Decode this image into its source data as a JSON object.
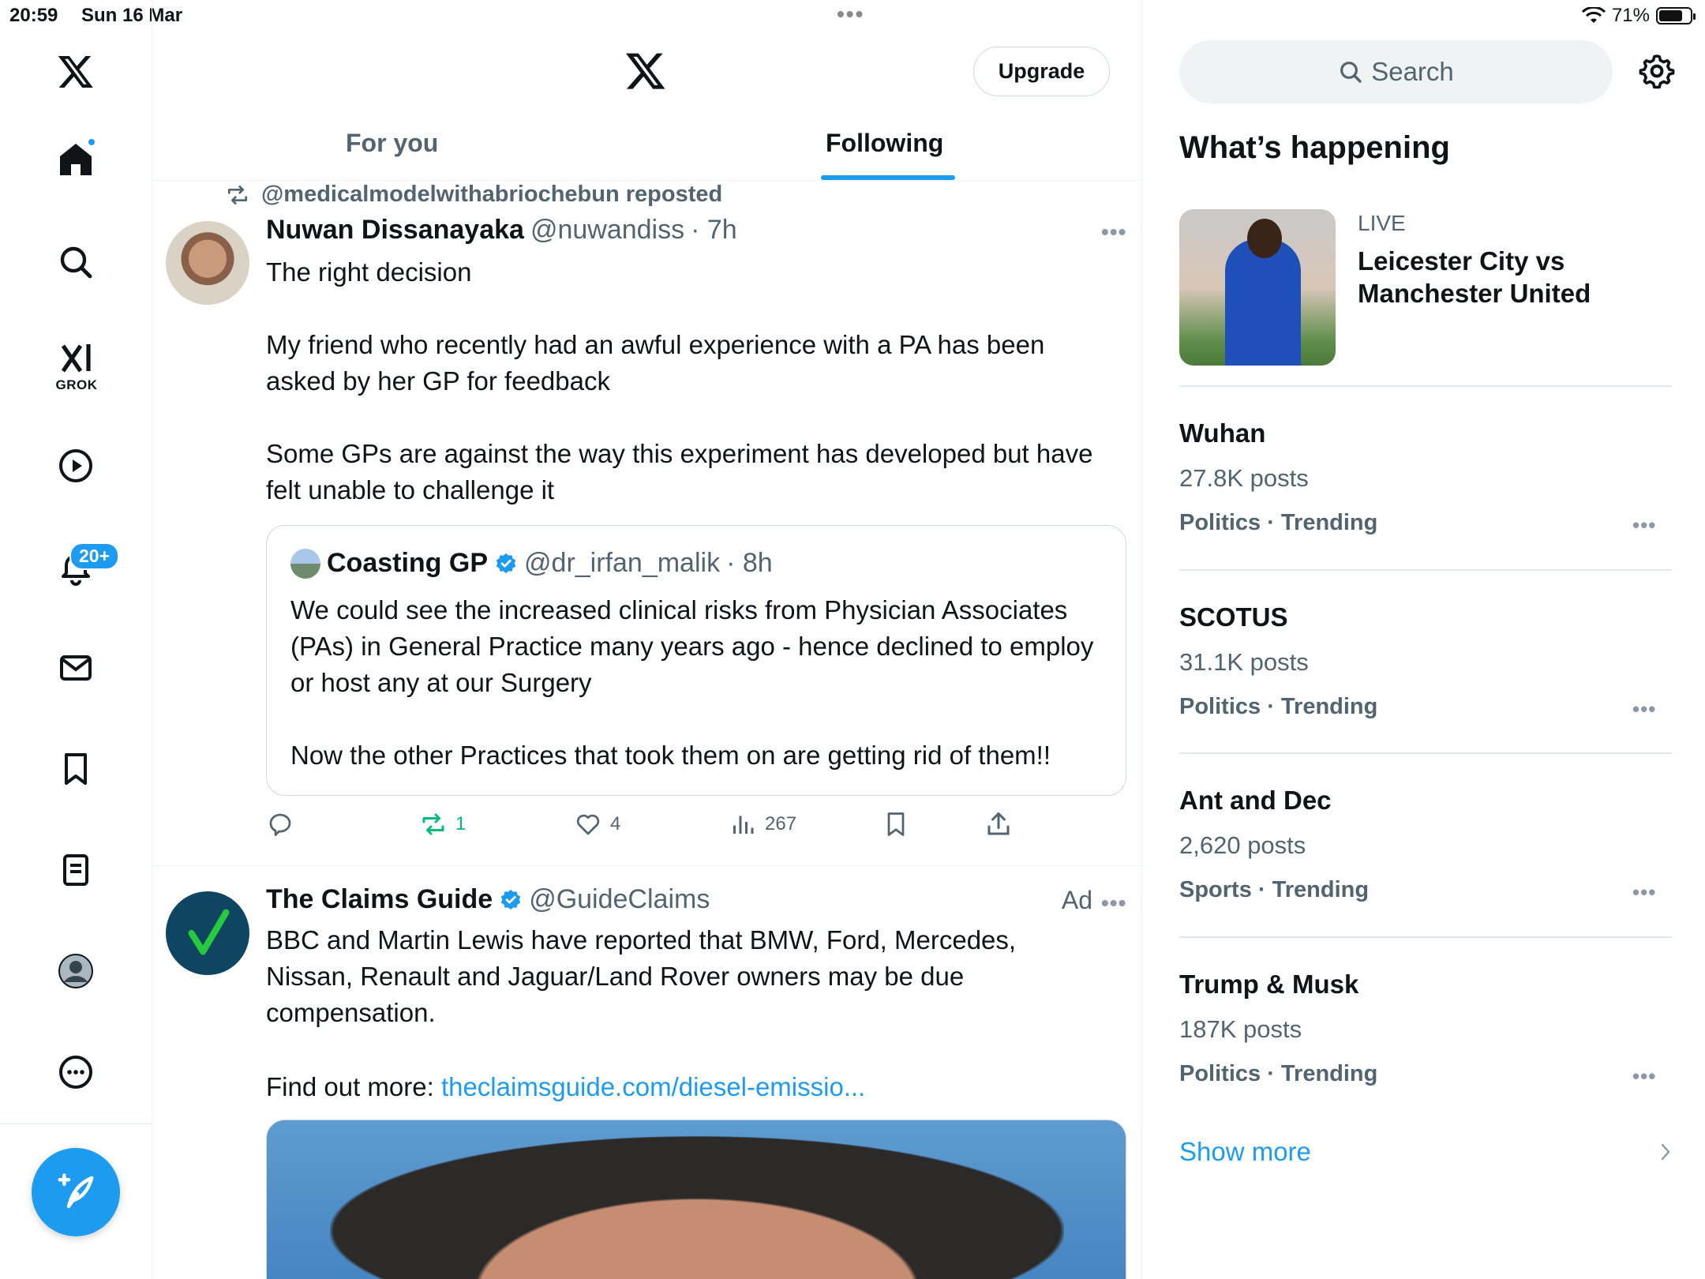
{
  "status_bar": {
    "time": "20:59",
    "date": "Sun 16 Mar",
    "battery": "71%"
  },
  "nav": {
    "grok_label": "GROK",
    "notifications_badge": "20+",
    "items": [
      "x-logo",
      "home",
      "search",
      "grok",
      "video",
      "notifications",
      "messages",
      "bookmarks",
      "lists",
      "profile",
      "more"
    ]
  },
  "header": {
    "upgrade_label": "Upgrade"
  },
  "tabs": [
    {
      "label": "For you",
      "selected": false
    },
    {
      "label": "Following",
      "selected": true
    }
  ],
  "posts": [
    {
      "repost_context": "@medicalmodelwithabriochebun reposted",
      "name": "Nuwan Dissanayaka",
      "handle": "@nuwandiss",
      "time": "· 7h",
      "text": "The right decision\n\nMy friend who recently had an awful experience with a PA has been asked by her GP for feedback\n\nSome GPs are against the way this experiment has developed but have felt unable to challenge it",
      "quote": {
        "name": "Coasting GP",
        "handle": "@dr_irfan_malik",
        "time": "· 8h",
        "text": "We could see the increased clinical risks from Physician Associates (PAs) in General Practice many years ago - hence declined to employ or host any at our Surgery\n\nNow the other Practices that took them on are getting rid of them!!"
      },
      "actions": {
        "replies": "",
        "reposts": "1",
        "likes": "4",
        "views": "267"
      }
    },
    {
      "name": "The Claims Guide",
      "handle": "@GuideClaims",
      "ad_label": "Ad",
      "text": "BBC and Martin Lewis have reported that BMW, Ford, Mercedes, Nissan, Renault and Jaguar/Land Rover owners may be due compensation.",
      "link_prefix": "Find out more: ",
      "link": "theclaimsguide.com/diesel-emissio..."
    }
  ],
  "sidebar": {
    "search_placeholder": "Search",
    "title": "What’s happening",
    "live": {
      "tag": "LIVE",
      "title": "Leicester City vs Manchester United"
    },
    "trends": [
      {
        "name": "Wuhan",
        "posts": "27.8K posts",
        "category": "Politics · Trending"
      },
      {
        "name": "SCOTUS",
        "posts": "31.1K posts",
        "category": "Politics · Trending"
      },
      {
        "name": "Ant and Dec",
        "posts": "2,620 posts",
        "category": "Sports · Trending"
      },
      {
        "name": "Trump & Musk",
        "posts": "187K posts",
        "category": "Politics · Trending"
      }
    ],
    "show_more": "Show more"
  },
  "colors": {
    "accent": "#1d9bf0",
    "repost_green": "#00ba7c",
    "secondary_text": "#536471"
  }
}
